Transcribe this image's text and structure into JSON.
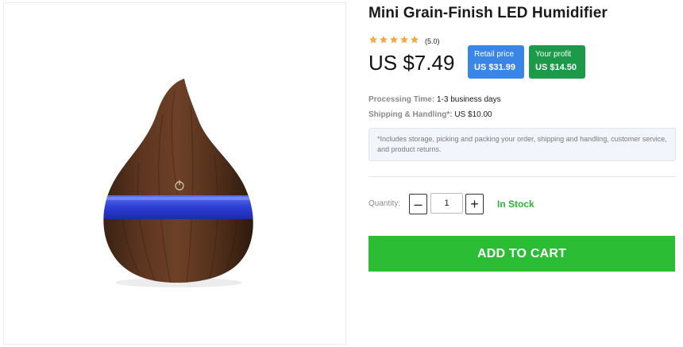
{
  "product": {
    "title": "Mini Grain-Finish LED Humidifier",
    "rating_stars": 5,
    "rating_text": "(5.0)",
    "price": "US $7.49",
    "image": "wood-grain-teardrop-humidifier"
  },
  "badges": {
    "retail_label": "Retail price",
    "retail_value": "US $31.99",
    "profit_label": "Your profit",
    "profit_value": "US $14.50"
  },
  "details": {
    "processing_label": "Processing Time:",
    "processing_value": "1-3 business days",
    "shipping_label": "Shipping & Handling*:",
    "shipping_value": "US $10.00",
    "note": "*Includes storage, picking and packing your order, shipping and handling, customer service, and product returns."
  },
  "quantity": {
    "label": "Quantity:",
    "minus": "–",
    "value": "1",
    "plus": "+",
    "stock": "In Stock"
  },
  "cart": {
    "label": "ADD TO CART"
  },
  "colors": {
    "star": "#f2a83b",
    "retail_badge": "#3a86e8",
    "profit_badge": "#1c9a4a",
    "stock_text": "#2bb33a",
    "cart_button": "#2bbd34"
  }
}
